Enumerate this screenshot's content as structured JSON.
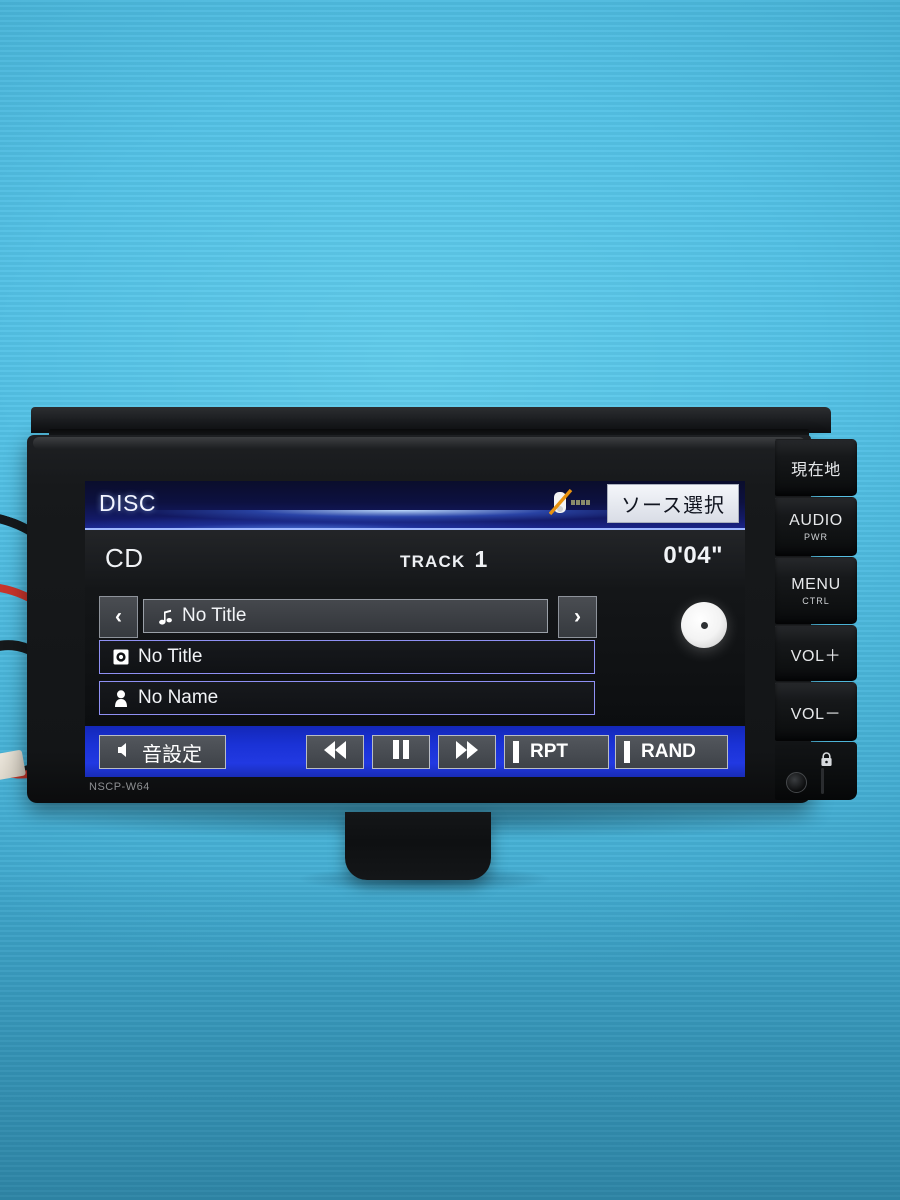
{
  "device": {
    "model_label": "NSCP-W64"
  },
  "screen": {
    "titlebar": {
      "source_label": "DISC",
      "phone_mute_icon": "phone-muted-icon",
      "source_select_button": "ソース選択"
    },
    "info": {
      "media_type": "CD",
      "track_word": "TRACK",
      "track_number": "1",
      "elapsed_time": "0'04\""
    },
    "fields": [
      {
        "icon": "music-note-icon",
        "label": "No Title",
        "kind": "track-title"
      },
      {
        "icon": "disc-icon",
        "label": "No Title",
        "kind": "album-title"
      },
      {
        "icon": "person-icon",
        "label": "No Name",
        "kind": "artist-name"
      }
    ],
    "nav": {
      "prev": "‹",
      "next": "›"
    },
    "disc_art_icon": "cd-disc-icon",
    "controls": {
      "sound_settings": "音設定",
      "sound_settings_icon": "speaker-icon",
      "rewind": "rewind-icon",
      "pause": "pause-icon",
      "fast_forward": "fast-forward-icon",
      "repeat": "RPT",
      "random": "RAND"
    },
    "colors": {
      "title_bar_blue": "#1a2488",
      "control_bar_blue": "#1a32d6",
      "field_border_violet": "#8f90f4",
      "screen_black": "#090a0c"
    }
  },
  "hardware_buttons": [
    {
      "main": "現在地",
      "sub": ""
    },
    {
      "main": "AUDIO",
      "sub": "PWR"
    },
    {
      "main": "MENU",
      "sub": "CTRL"
    },
    {
      "main": "VOL＋",
      "sub": ""
    },
    {
      "main": "VOL－",
      "sub": ""
    }
  ],
  "footer_panel": {
    "lock_icon": "lock-icon",
    "aux_jack": "aux-jack-icon"
  },
  "background": {
    "wall_color": "#54c2e6"
  }
}
